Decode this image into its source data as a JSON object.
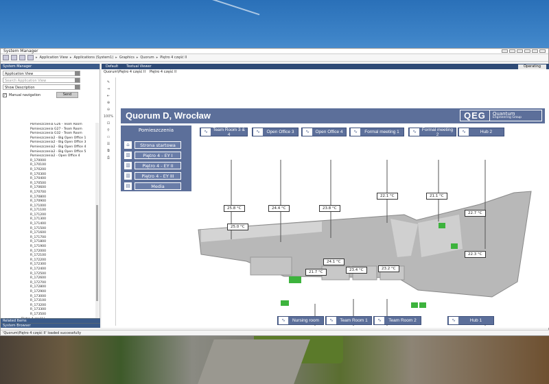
{
  "window": {
    "title": "System Manager"
  },
  "breadcrumb": [
    "Application View",
    "Applications (System1)",
    "Graphics",
    "Quorum",
    "Piętro 4 część II"
  ],
  "left_panel": {
    "header": "System Manager",
    "view_select": "Application View",
    "search_placeholder": "Search Application View",
    "description_select": "Show Description",
    "manual_nav_label": "Manual navigation",
    "send_label": "Send",
    "tree_items": [
      "Pomieszczenia G26 - Team Room",
      "Pomieszczenia G27 - Team Room",
      "Pomieszczenia G32 - Team Room",
      "Pomieszczenia2 - Big Open Office 1",
      "Pomieszczenia2 - Big Open Office 3",
      "Pomieszczenia2 - Big Open Office 4",
      "Pomieszczenia2 - Big Open Office 5",
      "Pomieszczenia2 - Open Office 4",
      "R_170000",
      "R_170100",
      "R_170200",
      "R_170300",
      "R_170400",
      "R_170500",
      "R_170600",
      "R_170700",
      "R_170800",
      "R_170900",
      "R_171000",
      "R_171100",
      "R_171200",
      "R_171300",
      "R_171400",
      "R_171500",
      "R_171600",
      "R_171700",
      "R_171800",
      "R_171900",
      "R_172000",
      "R_172100",
      "R_172200",
      "R_172300",
      "R_172400",
      "R_172500",
      "R_172600",
      "R_172700",
      "R_172800",
      "R_172900",
      "R_173000",
      "R_173100",
      "R_173200",
      "R_173300",
      "R_173500"
    ],
    "tree_level2": [
      "Piętro 4 część I",
      "Piętro 4 część II"
    ],
    "footer_tabs": [
      "Related Items",
      "System Browser"
    ]
  },
  "status_text": "'Quorum\\Piętro 4 część II' loaded successfully",
  "right_panel": {
    "tabs": [
      "Default",
      "Textual Viewer"
    ],
    "operating": "Operating",
    "crumb": [
      "Quorum\\Piętro 4 część II",
      "Piętro 4 część II"
    ],
    "zoom": "100%"
  },
  "graphic": {
    "title": "Quorum D, Wrocław",
    "logo_big": "QEG",
    "logo_name": "Quantum",
    "logo_sub": "Engineering Group",
    "menu_title": "Pomieszczenia",
    "menu_buttons": [
      "Strona startowa",
      "Piętro 4 - EY I",
      "Piętro 4 - EY II",
      "Piętro 4 - EY III",
      "Media"
    ],
    "top_rooms": [
      "Team Room 3 & 4",
      "Open Office 3",
      "Open Office 4",
      "Formal meeting 1",
      "Formal meeting 2",
      "Hub 2"
    ],
    "bottom_rooms": [
      "Nursing room",
      "Team Room 1",
      "Team Room 2",
      "Hub 1"
    ],
    "temps": [
      "25.8 °C",
      "25.0 °C",
      "24.4 °C",
      "23.8 °C",
      "22.1 °C",
      "21.1 °C",
      "22.7 °C",
      "24.1 °C",
      "21.7 °C",
      "23.4 °C",
      "23.2 °C",
      "22.3 °C"
    ]
  },
  "colors": {
    "panel": "#5c6f9a",
    "header_dark": "#2e4a76"
  }
}
